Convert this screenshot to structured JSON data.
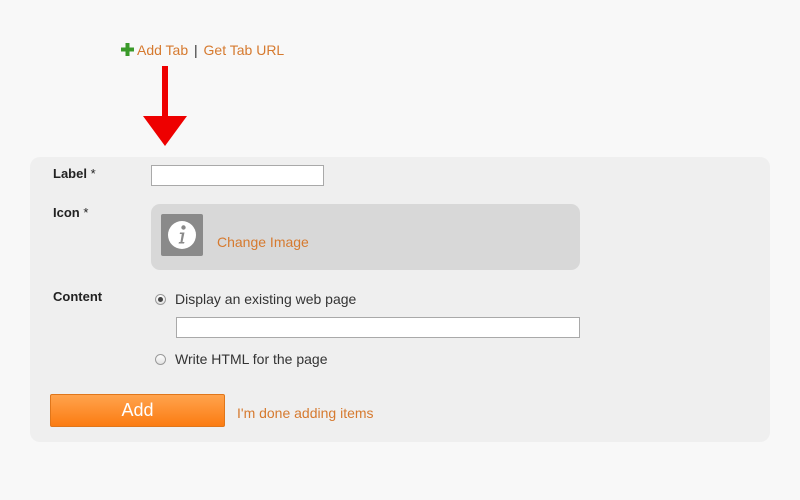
{
  "toolbar": {
    "add_tab_label": "Add Tab",
    "separator": "|",
    "get_tab_url_label": "Get Tab URL",
    "add_icon": "plus-icon",
    "add_icon_color": "#3a9a2a"
  },
  "annotation": {
    "arrow_color": "#ee0000",
    "arrow_icon": "arrow-down-icon"
  },
  "form": {
    "label": {
      "title": "Label",
      "required_marker": "*",
      "value": ""
    },
    "icon": {
      "title": "Icon",
      "required_marker": "*",
      "current_icon": "info-icon",
      "change_label": "Change Image"
    },
    "content": {
      "title": "Content",
      "options": [
        {
          "label": "Display an existing web page",
          "selected": true
        },
        {
          "label": "Write HTML for the page",
          "selected": false
        }
      ],
      "url_value": ""
    },
    "add_button_label": "Add",
    "done_link_label": "I'm done adding items"
  },
  "colors": {
    "link": "#d67a2f",
    "button": "#fb8c25",
    "panel": "#efefef"
  }
}
